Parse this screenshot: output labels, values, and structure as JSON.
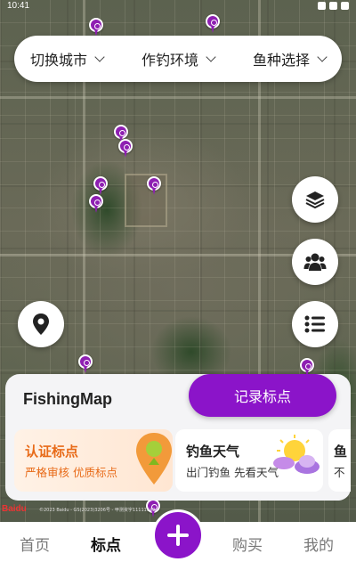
{
  "status_bar": {
    "time": "10:41"
  },
  "filters": [
    {
      "label": "切换城市"
    },
    {
      "label": "作钓环境"
    },
    {
      "label": "鱼种选择"
    }
  ],
  "panel": {
    "brand": "FishingMap",
    "record_button": "记录标点",
    "cards": [
      {
        "title": "认证标点",
        "subtitle": "严格审核 优质标点"
      },
      {
        "title": "钓鱼天气",
        "subtitle": "出门钓鱼 先看天气"
      },
      {
        "title": "鱼",
        "subtitle": "不"
      }
    ]
  },
  "map": {
    "watermark": "Baidu",
    "copyright": "©2023 Baidu - GS(2023)3206号 - 甲测资字11111342"
  },
  "nav": {
    "items": [
      "首页",
      "标点",
      "购买",
      "我的"
    ],
    "active": "标点"
  },
  "colors": {
    "accent": "#8b14c9",
    "pin": "#8e1fb2",
    "certified": "#e86b19"
  },
  "icons": [
    "layers-icon",
    "community-icon",
    "list-icon",
    "location-icon",
    "plus-icon"
  ]
}
